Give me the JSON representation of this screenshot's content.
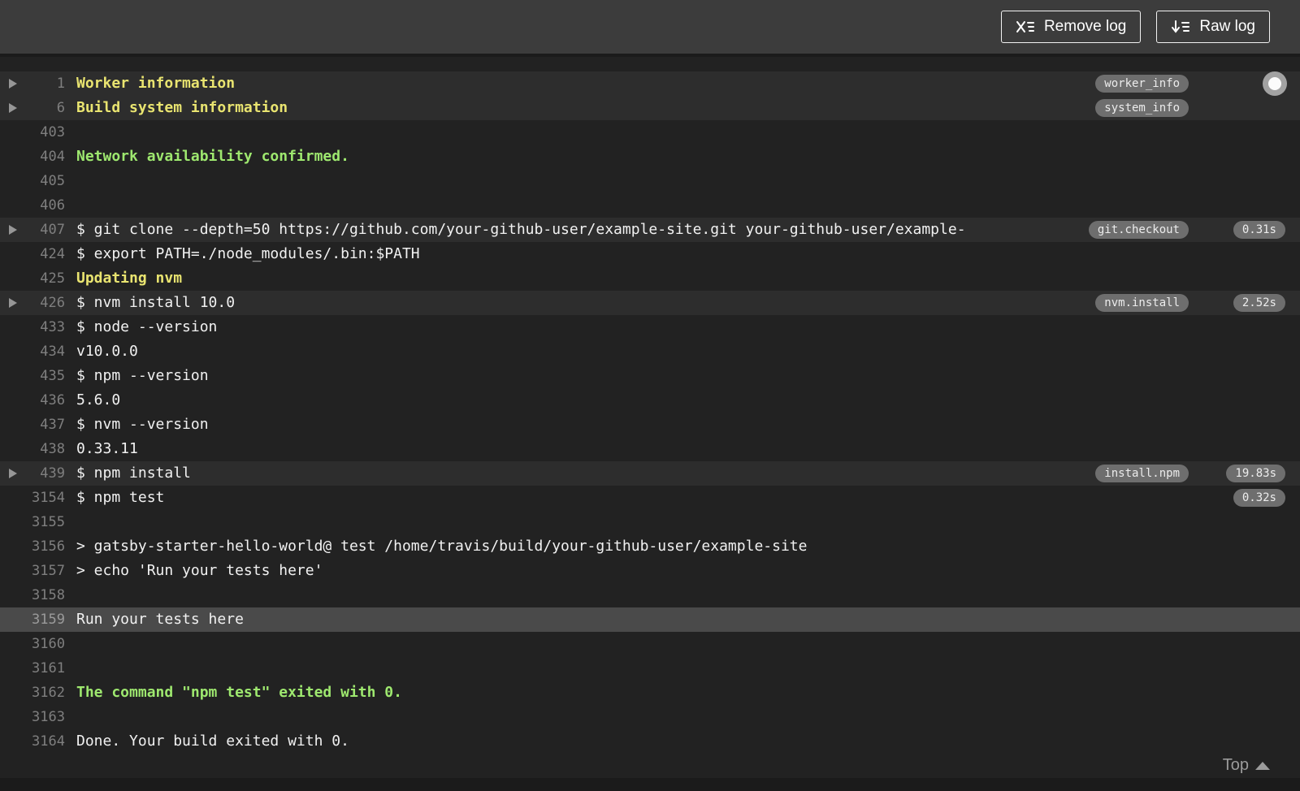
{
  "toolbar": {
    "remove_log_label": "Remove log",
    "raw_log_label": "Raw log"
  },
  "log": {
    "top_link_label": "Top",
    "rows": [
      {
        "line": "1",
        "text": "Worker information",
        "style": "yellow",
        "foldable": true,
        "tag": "worker_info",
        "duration": "",
        "bg": "fold"
      },
      {
        "line": "6",
        "text": "Build system information",
        "style": "yellow",
        "foldable": true,
        "tag": "system_info",
        "duration": "",
        "bg": "fold"
      },
      {
        "line": "403",
        "text": "",
        "style": "plain",
        "foldable": false,
        "tag": "",
        "duration": "",
        "bg": ""
      },
      {
        "line": "404",
        "text": "Network availability confirmed.",
        "style": "green",
        "foldable": false,
        "tag": "",
        "duration": "",
        "bg": ""
      },
      {
        "line": "405",
        "text": "",
        "style": "plain",
        "foldable": false,
        "tag": "",
        "duration": "",
        "bg": ""
      },
      {
        "line": "406",
        "text": "",
        "style": "plain",
        "foldable": false,
        "tag": "",
        "duration": "",
        "bg": ""
      },
      {
        "line": "407",
        "text": "$ git clone --depth=50 https://github.com/your-github-user/example-site.git your-github-user/example-",
        "style": "plain",
        "foldable": true,
        "tag": "git.checkout",
        "duration": "0.31s",
        "bg": "fold"
      },
      {
        "line": "424",
        "text": "$ export PATH=./node_modules/.bin:$PATH",
        "style": "plain",
        "foldable": false,
        "tag": "",
        "duration": "",
        "bg": ""
      },
      {
        "line": "425",
        "text": "Updating nvm",
        "style": "yellow",
        "foldable": false,
        "tag": "",
        "duration": "",
        "bg": ""
      },
      {
        "line": "426",
        "text": "$ nvm install 10.0",
        "style": "plain",
        "foldable": true,
        "tag": "nvm.install",
        "duration": "2.52s",
        "bg": "fold"
      },
      {
        "line": "433",
        "text": "$ node --version",
        "style": "plain",
        "foldable": false,
        "tag": "",
        "duration": "",
        "bg": ""
      },
      {
        "line": "434",
        "text": "v10.0.0",
        "style": "plain",
        "foldable": false,
        "tag": "",
        "duration": "",
        "bg": ""
      },
      {
        "line": "435",
        "text": "$ npm --version",
        "style": "plain",
        "foldable": false,
        "tag": "",
        "duration": "",
        "bg": ""
      },
      {
        "line": "436",
        "text": "5.6.0",
        "style": "plain",
        "foldable": false,
        "tag": "",
        "duration": "",
        "bg": ""
      },
      {
        "line": "437",
        "text": "$ nvm --version",
        "style": "plain",
        "foldable": false,
        "tag": "",
        "duration": "",
        "bg": ""
      },
      {
        "line": "438",
        "text": "0.33.11",
        "style": "plain",
        "foldable": false,
        "tag": "",
        "duration": "",
        "bg": ""
      },
      {
        "line": "439",
        "text": "$ npm install",
        "style": "plain",
        "foldable": true,
        "tag": "install.npm",
        "duration": "19.83s",
        "bg": "fold"
      },
      {
        "line": "3154",
        "text": "$ npm test",
        "style": "plain",
        "foldable": false,
        "tag": "",
        "duration": "0.32s",
        "bg": ""
      },
      {
        "line": "3155",
        "text": "",
        "style": "plain",
        "foldable": false,
        "tag": "",
        "duration": "",
        "bg": ""
      },
      {
        "line": "3156",
        "text": "> gatsby-starter-hello-world@ test /home/travis/build/your-github-user/example-site",
        "style": "plain",
        "foldable": false,
        "tag": "",
        "duration": "",
        "bg": ""
      },
      {
        "line": "3157",
        "text": "> echo 'Run your tests here'",
        "style": "plain",
        "foldable": false,
        "tag": "",
        "duration": "",
        "bg": ""
      },
      {
        "line": "3158",
        "text": "",
        "style": "plain",
        "foldable": false,
        "tag": "",
        "duration": "",
        "bg": ""
      },
      {
        "line": "3159",
        "text": "Run your tests here",
        "style": "plain",
        "foldable": false,
        "tag": "",
        "duration": "",
        "bg": "selected"
      },
      {
        "line": "3160",
        "text": "",
        "style": "plain",
        "foldable": false,
        "tag": "",
        "duration": "",
        "bg": ""
      },
      {
        "line": "3161",
        "text": "",
        "style": "plain",
        "foldable": false,
        "tag": "",
        "duration": "",
        "bg": ""
      },
      {
        "line": "3162",
        "text": "The command \"npm test\" exited with 0.",
        "style": "green",
        "foldable": false,
        "tag": "",
        "duration": "",
        "bg": ""
      },
      {
        "line": "3163",
        "text": "",
        "style": "plain",
        "foldable": false,
        "tag": "",
        "duration": "",
        "bg": ""
      },
      {
        "line": "3164",
        "text": "Done. Your build exited with 0.",
        "style": "plain",
        "foldable": false,
        "tag": "",
        "duration": "",
        "bg": ""
      }
    ]
  },
  "colors": {
    "topbar_bg": "#3c3c3c",
    "log_bg": "#222222",
    "fold_row_bg": "#2d2d2d",
    "selected_row_bg": "#4a4a4a",
    "header_yellow": "#e9e470",
    "success_green": "#9ee86f",
    "pill_bg": "#6e6e6e",
    "line_number_gray": "#7f7f7f"
  }
}
